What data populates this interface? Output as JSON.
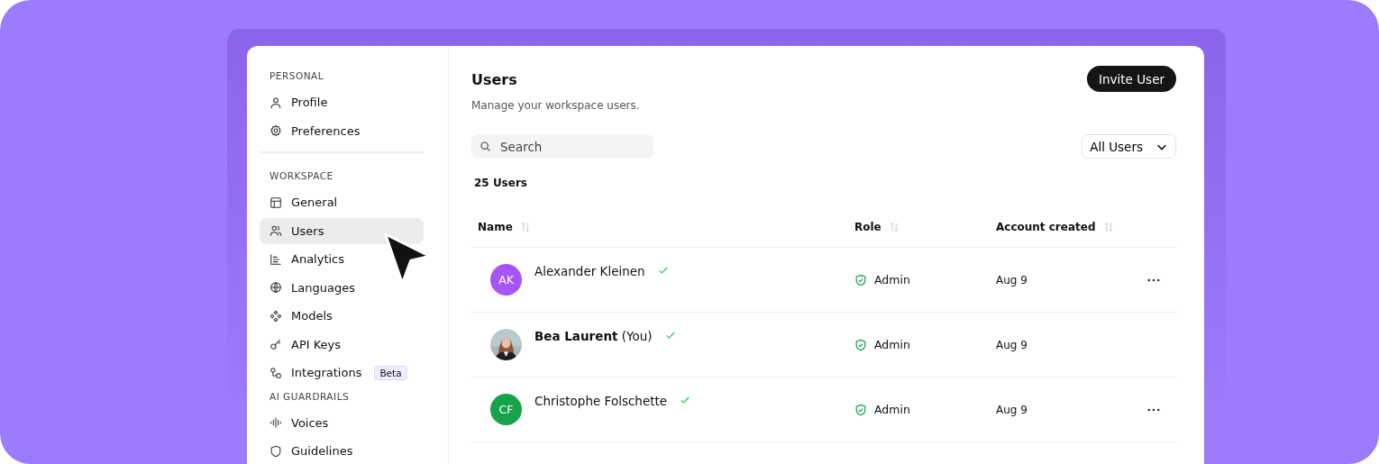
{
  "sidebar": {
    "sections": [
      {
        "heading": "PERSONAL",
        "divider": true,
        "items": [
          {
            "label": "Profile",
            "selected": false
          },
          {
            "label": "Preferences",
            "selected": false
          }
        ]
      },
      {
        "heading": "WORKSPACE",
        "divider": false,
        "items": [
          {
            "label": "General",
            "selected": false
          },
          {
            "label": "Users",
            "selected": true
          },
          {
            "label": "Analytics",
            "selected": false
          },
          {
            "label": "Languages",
            "selected": false
          },
          {
            "label": "Models",
            "selected": false
          },
          {
            "label": "API Keys",
            "selected": false
          },
          {
            "label": "Integrations",
            "selected": false,
            "badge": "Beta"
          }
        ]
      },
      {
        "heading": "AI GUARDRAILS",
        "divider": false,
        "items": [
          {
            "label": "Voices",
            "selected": false
          },
          {
            "label": "Guidelines",
            "selected": false
          }
        ]
      }
    ]
  },
  "header": {
    "title": "Users",
    "subtitle": "Manage your workspace users.",
    "invite_button": "Invite User"
  },
  "search": {
    "placeholder": "Search"
  },
  "filter": {
    "value": "All Users"
  },
  "count": "25 Users",
  "table": {
    "columns": [
      "Name",
      "Role",
      "Account created"
    ],
    "rows": [
      {
        "avatar": {
          "kind": "initials",
          "text": "AK",
          "color": "#a855f7"
        },
        "name": "Alexander Kleinen",
        "verified": true,
        "role": "Admin",
        "created": "Aug 9",
        "actions": true
      },
      {
        "name": "**Bea Laurent** (You)",
        "verified": true,
        "role": "Admin",
        "created": "Aug 9",
        "actions": false
      },
      {
        "avatar": {
          "kind": "initials",
          "text": "CF",
          "color": "#16a34a"
        },
        "name": "Christophe Folschette",
        "verified": true,
        "role": "Admin",
        "created": "Aug 9",
        "actions": true
      }
    ]
  }
}
